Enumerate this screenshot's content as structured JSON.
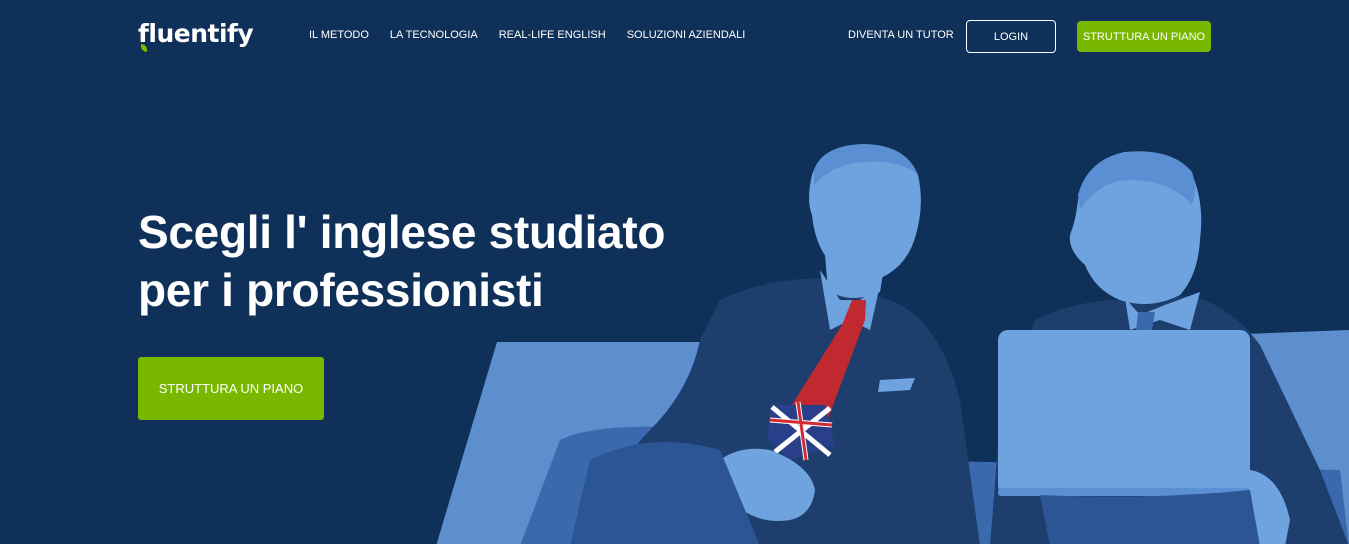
{
  "brand": {
    "logo_text": "fluentify",
    "accent_color": "#79b800",
    "background_color": "#0f3159"
  },
  "nav": {
    "links": [
      {
        "label": "IL METODO"
      },
      {
        "label": "LA TECNOLOGIA"
      },
      {
        "label": "REAL-LIFE ENGLISH"
      },
      {
        "label": "SOLUZIONI AZIENDALI"
      }
    ],
    "tutor_label": "DIVENTA UN TUTOR",
    "login_label": "LOGIN",
    "cta_label": "STRUTTURA UN PIANO"
  },
  "hero": {
    "title_line1": "Scegli l' inglese studiato",
    "title_line2": "per i professionisti",
    "cta_label": "STRUTTURA UN PIANO",
    "image_subject": "two-businessmen-on-sofa-with-laptop-and-union-jack-tie"
  }
}
